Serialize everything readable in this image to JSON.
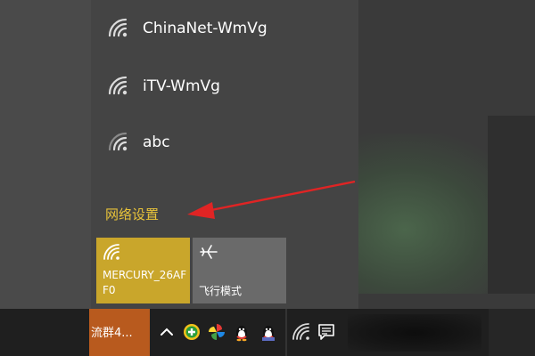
{
  "networks": [
    {
      "ssid": "ChinaNet-WmVg",
      "icon": "wifi-signal-icon"
    },
    {
      "ssid": "iTV-WmVg",
      "icon": "wifi-signal-icon"
    },
    {
      "ssid": "abc",
      "icon": "wifi-signal-icon"
    }
  ],
  "settings_link": "网络设置",
  "quick_actions": {
    "wifi": {
      "label": "MERCURY_26AFF0",
      "icon": "wifi-icon",
      "color": "#c9a62b"
    },
    "airplane": {
      "label": "飞行模式",
      "icon": "airplane-icon"
    }
  },
  "taskbar": {
    "app_label": "流群4...",
    "app_color": "#b85a1e",
    "tray_icons": [
      "chevron-up-icon",
      "shield-plus-icon",
      "pinwheel-icon",
      "qq-penguin-icon",
      "qq-penguin-icon",
      "cleaner-icon",
      "wifi-icon",
      "notification-icon"
    ]
  },
  "colors": {
    "link": "#e8c33a",
    "flyout": "#444444"
  }
}
